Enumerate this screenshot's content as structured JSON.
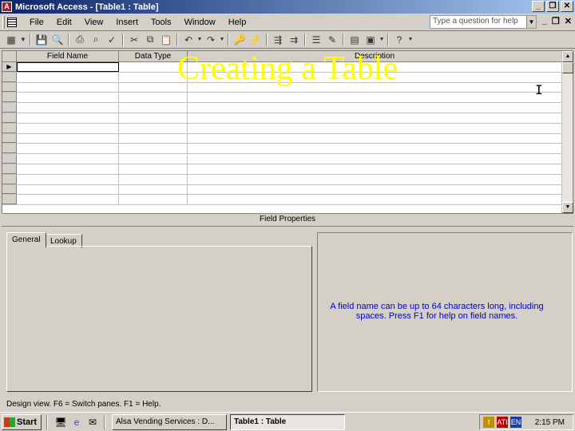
{
  "window": {
    "title": "Microsoft Access - [Table1 : Table]"
  },
  "menu": [
    "File",
    "Edit",
    "View",
    "Insert",
    "Tools",
    "Window",
    "Help"
  ],
  "help_box": {
    "placeholder": "Type a question for help"
  },
  "grid": {
    "columns": [
      "Field Name",
      "Data Type",
      "Description"
    ],
    "row_count": 14
  },
  "overlay_title": "Creating a Table",
  "field_properties": {
    "label": "Field Properties",
    "tabs": [
      "General",
      "Lookup"
    ],
    "help_text": "A field name can be up to 64 characters long, including spaces. Press F1 for help on field names."
  },
  "status_bar": "Design view.  F6 = Switch panes.  F1 = Help.",
  "taskbar": {
    "start_label": "Start",
    "tasks": [
      "Alsa Vending Services : D...",
      "Table1 : Table"
    ],
    "clock": "2:15 PM",
    "lang": "EN"
  }
}
